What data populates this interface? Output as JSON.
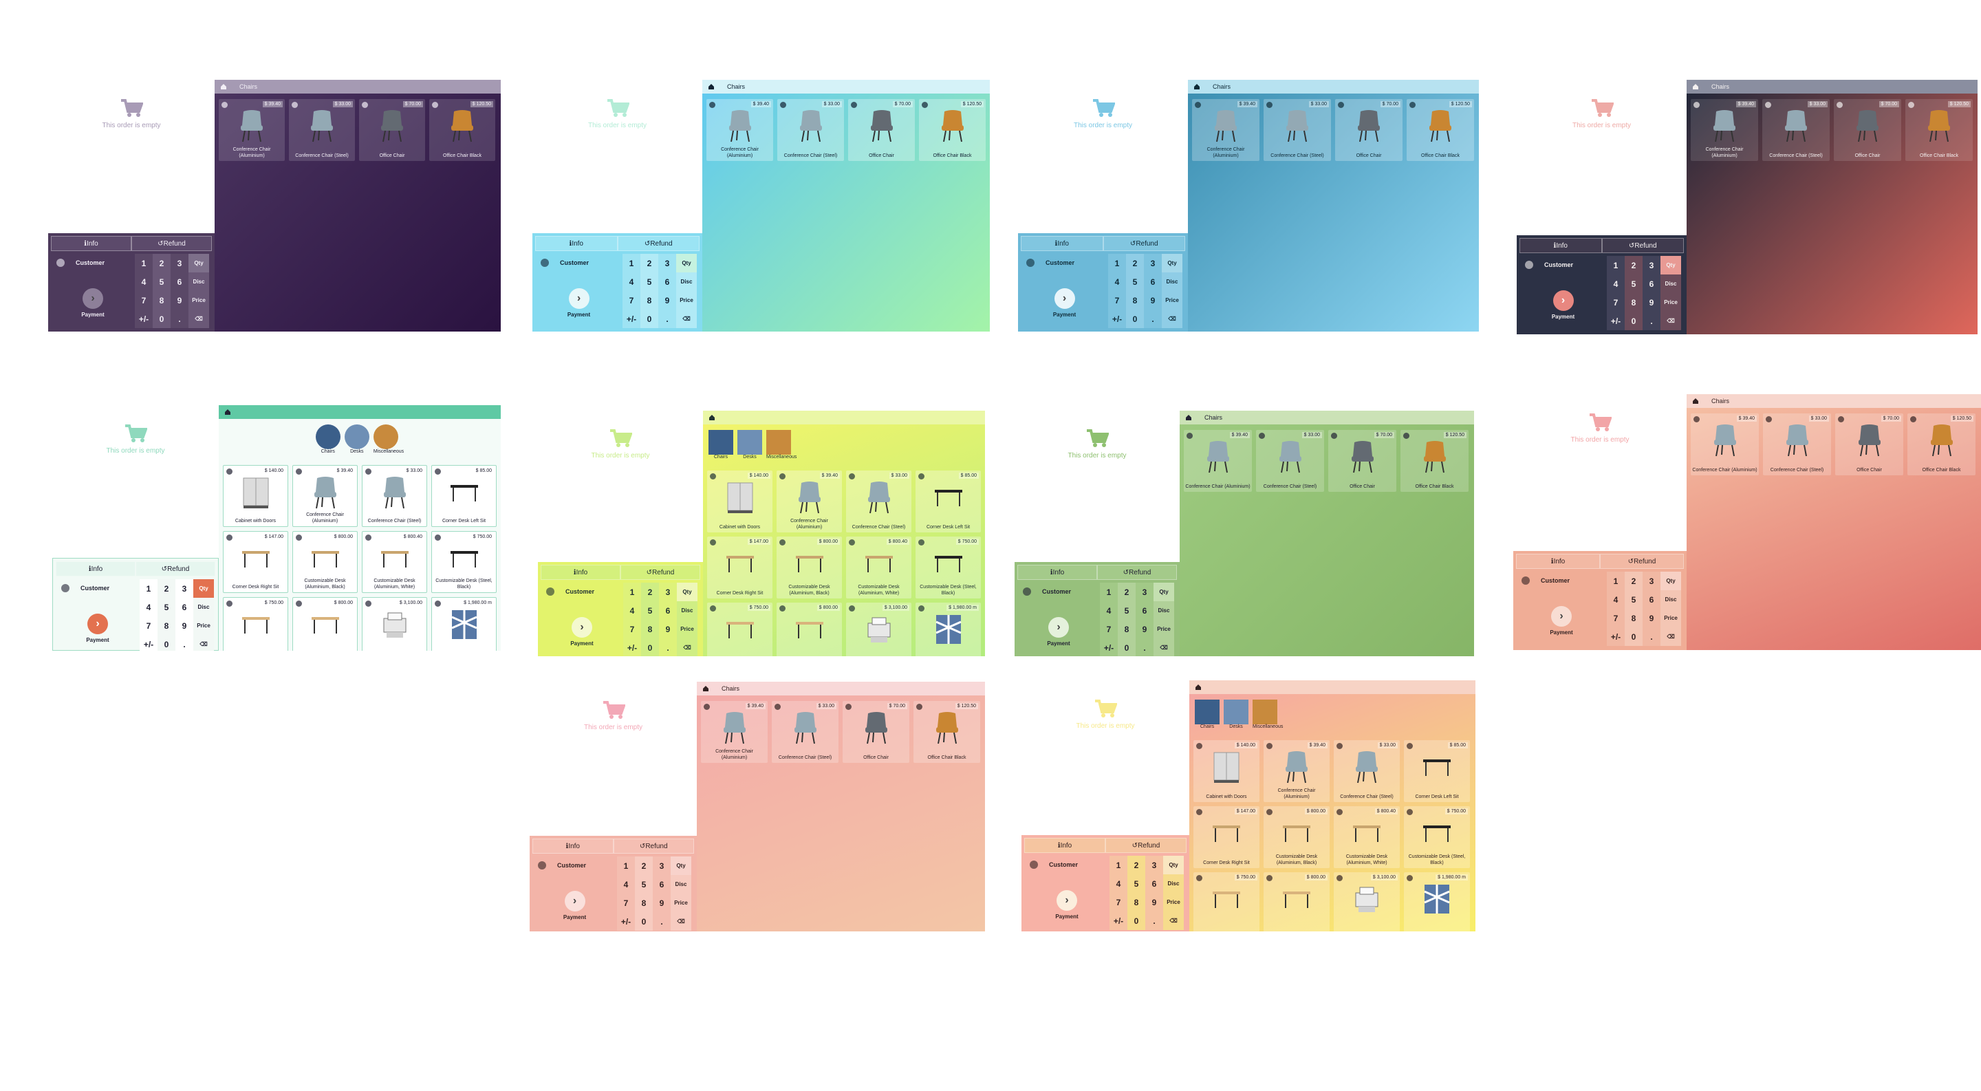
{
  "labels": {
    "empty_order": "This order is empty",
    "info_tab": "Info",
    "refund_tab": "Refund",
    "customer": "Customer",
    "payment": "Payment",
    "breadcrumb_chairs": "Chairs"
  },
  "numpad": {
    "rows": [
      [
        "1",
        "2",
        "3",
        "Qty"
      ],
      [
        "4",
        "5",
        "6",
        "Disc"
      ],
      [
        "7",
        "8",
        "9",
        "Price"
      ],
      [
        "+/-",
        "0",
        ".",
        "⌫"
      ]
    ]
  },
  "chair_products": [
    {
      "name": "Conference Chair (Aluminium)",
      "price": "$ 39.40",
      "kind": "chair-grey"
    },
    {
      "name": "Conference Chair (Steel)",
      "price": "$ 33.00",
      "kind": "chair-grey"
    },
    {
      "name": "Office Chair",
      "price": "$ 70.00",
      "kind": "chair-dark"
    },
    {
      "name": "Office Chair Black",
      "price": "$ 120.50",
      "kind": "chair-orange"
    }
  ],
  "all_products": [
    {
      "name": "Cabinet with Doors",
      "price": "$ 140.00",
      "kind": "cabinet"
    },
    {
      "name": "Conference Chair (Aluminium)",
      "price": "$ 39.40",
      "kind": "chair-grey"
    },
    {
      "name": "Conference Chair (Steel)",
      "price": "$ 33.00",
      "kind": "chair-grey"
    },
    {
      "name": "Corner Desk Left Sit",
      "price": "$ 85.00",
      "kind": "desk-dark"
    },
    {
      "name": "Corner Desk Right Sit",
      "price": "$ 147.00",
      "kind": "desk"
    },
    {
      "name": "Customizable Desk (Aluminium, Black)",
      "price": "$ 800.00",
      "kind": "desk"
    },
    {
      "name": "Customizable Desk (Aluminium, White)",
      "price": "$ 800.40",
      "kind": "desk"
    },
    {
      "name": "Customizable Desk (Steel, Black)",
      "price": "$ 750.00",
      "kind": "desk-dark"
    },
    {
      "name": "",
      "price": "$ 750.00",
      "kind": "desk-wood"
    },
    {
      "name": "",
      "price": "$ 800.00",
      "kind": "desk-wood"
    },
    {
      "name": "",
      "price": "$ 3,100.00",
      "kind": "printer"
    },
    {
      "name": "",
      "price": "$ 1,980.00 m",
      "kind": "pattern"
    }
  ],
  "categories": [
    {
      "label": "Chairs",
      "kind": "cat-blue"
    },
    {
      "label": "Desks",
      "kind": "cat-mix"
    },
    {
      "label": "Miscellaneous",
      "kind": "cat-brown"
    }
  ],
  "themes": [
    {
      "name": "dark-purple",
      "accent": "#3a2150"
    },
    {
      "name": "sky-green",
      "accent": "#7fd9f0"
    },
    {
      "name": "ocean-blue",
      "accent": "#4fa7c9"
    },
    {
      "name": "night-coral",
      "accent": "#e06558"
    },
    {
      "name": "mint-light",
      "accent": "#5fc9a4"
    },
    {
      "name": "lime-yellow",
      "accent": "#d8ee6c"
    },
    {
      "name": "moss-green",
      "accent": "#8dbb6c"
    },
    {
      "name": "peach-coral",
      "accent": "#e8866a"
    },
    {
      "name": "pink-peach",
      "accent": "#f3b2b0"
    },
    {
      "name": "pink-yellow",
      "accent": "#f7e86a"
    }
  ]
}
